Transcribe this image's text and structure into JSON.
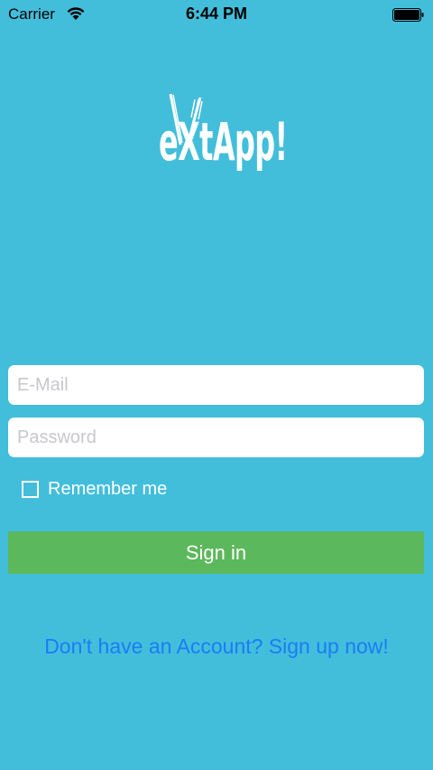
{
  "status_bar": {
    "carrier": "Carrier",
    "time": "6:44 PM",
    "icons": [
      "wifi-icon",
      "battery-icon"
    ]
  },
  "logo": {
    "text": "eXtApp!"
  },
  "form": {
    "email_placeholder": "E-Mail",
    "password_placeholder": "Password",
    "remember_label": "Remember me",
    "remember_checked": false,
    "signin_label": "Sign in"
  },
  "footer": {
    "signup_text": "Don't have an Account? Sign up now!"
  },
  "colors": {
    "background": "#42bedb",
    "signin_button": "#5cb85c",
    "link": "#1a7cf6"
  }
}
